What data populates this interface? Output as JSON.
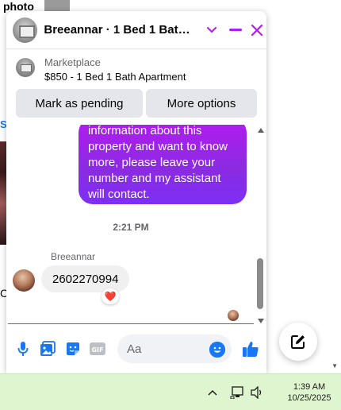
{
  "background": {
    "photo_label": "photo",
    "blue_letter": "S",
    "c_letter": "C"
  },
  "chat": {
    "title": "Breeannar · 1 Bed 1 Bath A...",
    "listing": {
      "source": "Marketplace",
      "price_title": "$850 - 1 Bed 1 Bath Apartment"
    },
    "buttons": {
      "mark_pending": "Mark as pending",
      "more_options": "More options"
    },
    "messages": {
      "outgoing_text": "information about this property and want to know more, please leave your number and my assistant will contact.",
      "time": "2:21 PM",
      "sender_name": "Breeannar",
      "incoming_text": "2602270994",
      "reaction": "❤️"
    },
    "composer": {
      "placeholder": "Aa"
    },
    "colors": {
      "accent": "#b31bf0",
      "outgoing_bubble_start": "#b31bf0",
      "outgoing_bubble_end": "#7d2ff5",
      "composer_icons": "#1877f2"
    }
  },
  "icons": {
    "header": [
      "chevron-down-icon",
      "minimize-icon",
      "close-icon"
    ],
    "composer": [
      "microphone-icon",
      "image-icon",
      "sticker-icon",
      "gif-icon",
      "emoji-icon",
      "thumbs-up-icon"
    ],
    "fab": "compose-icon",
    "taskbar": [
      "chevron-up-icon",
      "network-icon",
      "volume-icon"
    ]
  },
  "taskbar": {
    "time": "1:39 AM",
    "date": "10/25/2025"
  }
}
